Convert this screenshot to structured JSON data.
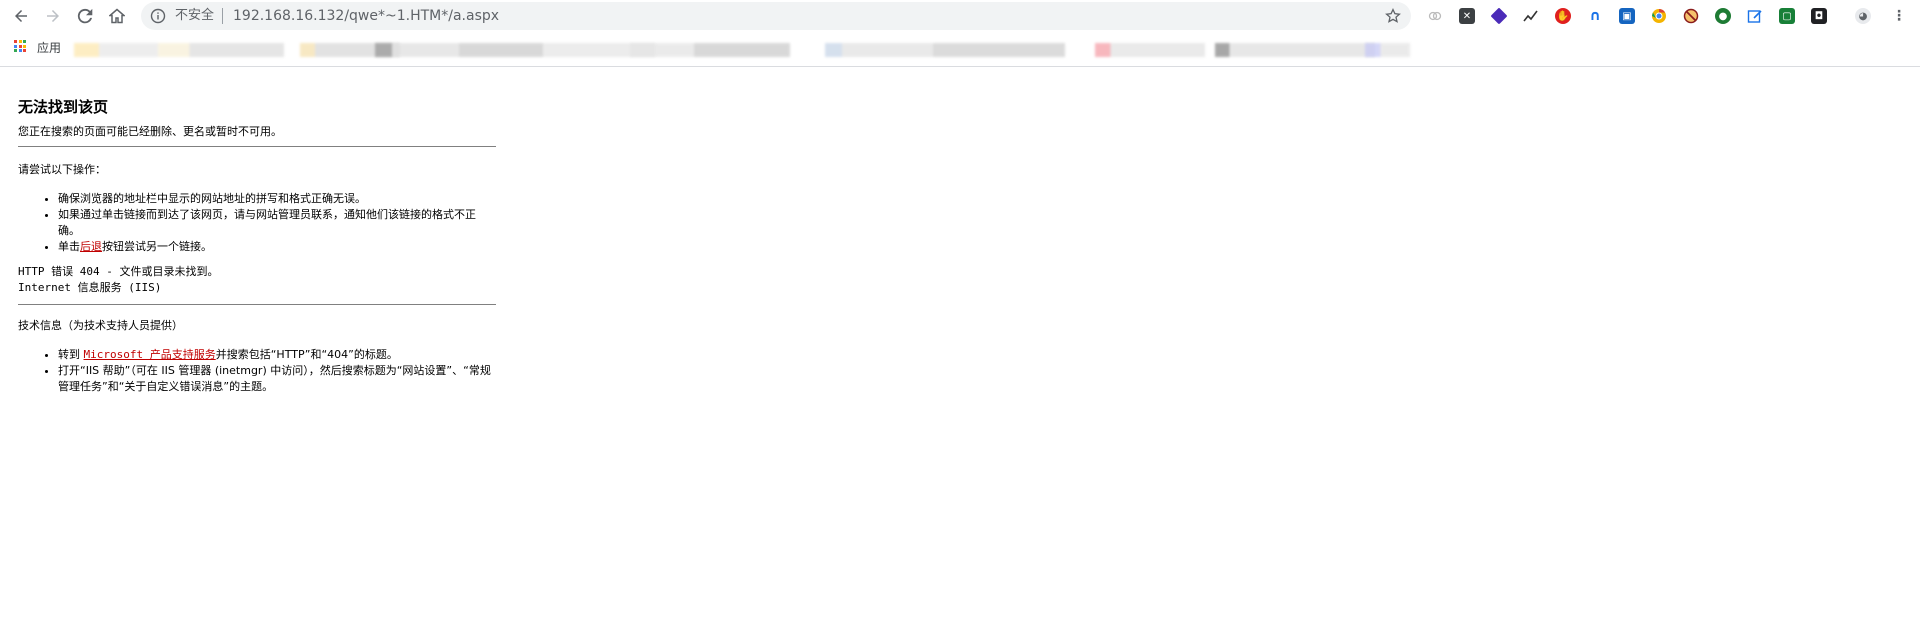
{
  "browser": {
    "url": "192.168.16.132/qwe*~1.HTM*/a.aspx",
    "security_label": "不安全",
    "bookmarks_apps_label": "应用",
    "extensions": [
      "link-icon",
      "x-icon",
      "gem-icon",
      "chart-icon",
      "adblock-icon",
      "arc-icon",
      "devtools-icon",
      "chrome-icon",
      "no-script-icon",
      "shield-icon",
      "edit-icon",
      "screen-icon",
      "disguise-icon",
      "avatar-icon",
      "more-icon"
    ]
  },
  "page": {
    "title": "无法找到该页",
    "subtitle": "您正在搜索的页面可能已经删除、更名或暂时不可用。",
    "try_heading": "请尝试以下操作：",
    "try_items": {
      "item1": "确保浏览器的地址栏中显示的网站地址的拼写和格式正确无误。",
      "item2": "如果通过单击链接而到达了该网页，请与网站管理员联系，通知他们该链接的格式不正确。",
      "item3_prefix": "单击",
      "item3_link": "后退",
      "item3_suffix": "按钮尝试另一个链接。"
    },
    "error_line1": "HTTP 错误 404 - 文件或目录未找到。",
    "error_line2": "Internet 信息服务 (IIS)",
    "tech_heading": "技术信息（为技术支持人员提供）",
    "tech_items": {
      "item1_prefix": "转到 ",
      "item1_link": "Microsoft 产品支持服务",
      "item1_suffix": "并搜索包括“HTTP”和“404”的标题。",
      "item2": "打开“IIS 帮助”（可在 IIS 管理器 (inetmgr) 中访问），然后搜索标题为“网站设置”、“常规管理任务”和“关于自定义错误消息”的主题。"
    }
  }
}
